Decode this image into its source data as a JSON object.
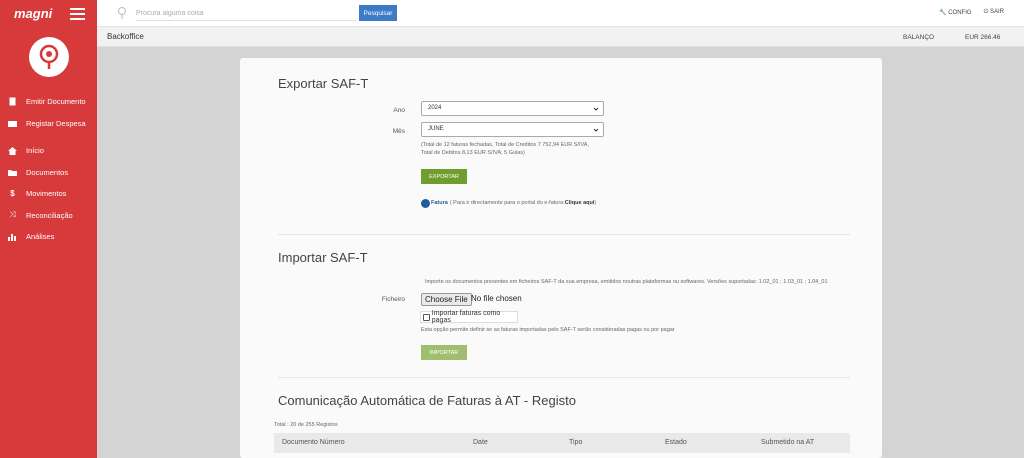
{
  "app": {
    "logo": "magni"
  },
  "sidebar": {
    "items": [
      {
        "label": "Emitir Documento",
        "icon": "document-icon"
      },
      {
        "label": "Registar Despesa",
        "icon": "expense-icon"
      },
      {
        "label": "Início",
        "icon": "home-icon"
      },
      {
        "label": "Documentos",
        "icon": "folder-icon"
      },
      {
        "label": "Movimentos",
        "icon": "dollar-icon"
      },
      {
        "label": "Reconciliação",
        "icon": "shuffle-icon"
      },
      {
        "label": "Análises",
        "icon": "bar-chart-icon"
      }
    ]
  },
  "topbar": {
    "search_placeholder": "Procura alguma coisa",
    "search_button": "Pesquisar",
    "config_label": "CONFIG",
    "exit_label": "SAIR"
  },
  "subheader": {
    "breadcrumb": "Backoffice",
    "balance_label": "BALANÇO",
    "balance_value": "EUR 266.46"
  },
  "export": {
    "title": "Exportar SAF-T",
    "year_label": "Ano",
    "year_value": "2024",
    "month_label": "Mês",
    "month_value": "JUNE",
    "summary_line1": "(Total de 12 faturas fechadas, Total de Creditos 7 752,94 EUR S/IVA,",
    "summary_line2": "Total de Debitos 8,13 EUR S/IVA; 5 Guias)",
    "export_button": "EXPORTAR",
    "efatura_brand": "Fatura",
    "efatura_text": "( Para ir directamente para o portal do e-fatura: ",
    "efatura_link": "Clique aqui",
    "efatura_close": " )"
  },
  "import": {
    "title": "Importar SAF-T",
    "description": "Importe os documentos presentes em ficheiros SAF-T da sua empresa, emitidos noutras plataformas ou softwares. Versões suportadas: 1.02_01 ; 1.03_01 ; 1.04_01",
    "file_label": "Ficheiro",
    "file_button": "Choose File",
    "file_status": "No file chosen",
    "checkbox_label": "Importar faturas como pagas",
    "checkbox_hint": "Esta opção permite definir se as faturas importadas pelo SAF-T serão consideradas pagas ou por pagar",
    "import_button": "IMPORTAR"
  },
  "communication": {
    "title": "Comunicação Automática de Faturas à AT - Registo",
    "total_text": "Total : 20 de 255 Registos",
    "columns": [
      "Documento Número",
      "Date",
      "Tipo",
      "Estado",
      "Submetido na AT"
    ]
  },
  "colors": {
    "sidebar": "#d63a3a",
    "primary_button": "#3d7ac7",
    "green_button": "#6f9e2f"
  }
}
